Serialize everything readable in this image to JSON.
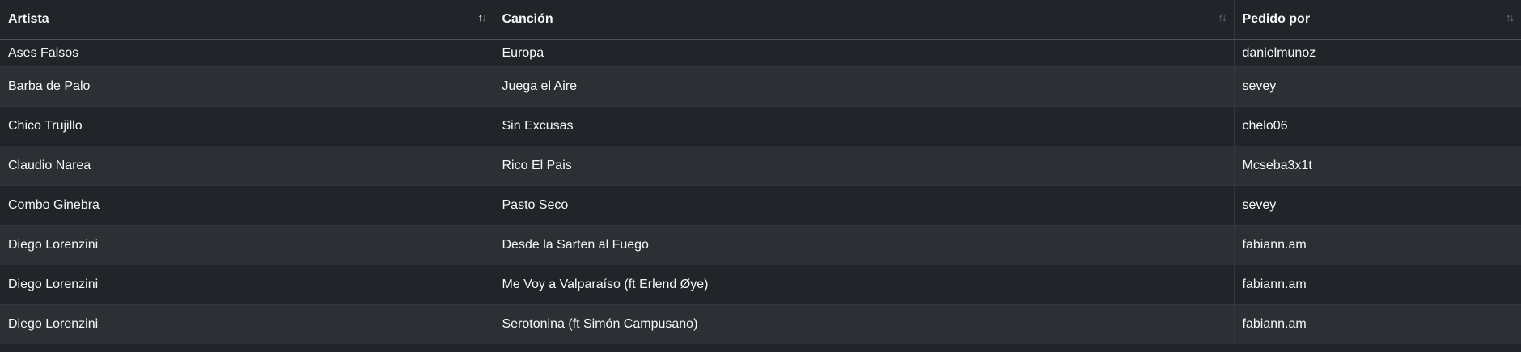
{
  "table": {
    "columns": [
      {
        "label": "Artista",
        "sort_icon": "sort-asc-icon"
      },
      {
        "label": "Canción",
        "sort_icon": "sort-icon"
      },
      {
        "label": "Pedido por",
        "sort_icon": "sort-icon"
      }
    ],
    "rows": [
      [
        "Ases Falsos",
        "Europa",
        "danielmunoz"
      ],
      [
        "Barba de Palo",
        "Juega el Aire",
        "sevey"
      ],
      [
        "Chico Trujillo",
        "Sin Excusas",
        "chelo06"
      ],
      [
        "Claudio Narea",
        "Rico El Pais",
        "Mcseba3x1t"
      ],
      [
        "Combo Ginebra",
        "Pasto Seco",
        "sevey"
      ],
      [
        "Diego Lorenzini",
        "Desde la Sarten al Fuego",
        "fabiann.am"
      ],
      [
        "Diego Lorenzini",
        "Me Voy a Valparaíso (ft Erlend Øye)",
        "fabiann.am"
      ],
      [
        "Diego Lorenzini",
        "Serotonina (ft Simón Campusano)",
        "fabiann.am"
      ]
    ]
  },
  "colors": {
    "background": "#212529",
    "row_alt": "#2c3034",
    "text": "#f8f9fa"
  }
}
